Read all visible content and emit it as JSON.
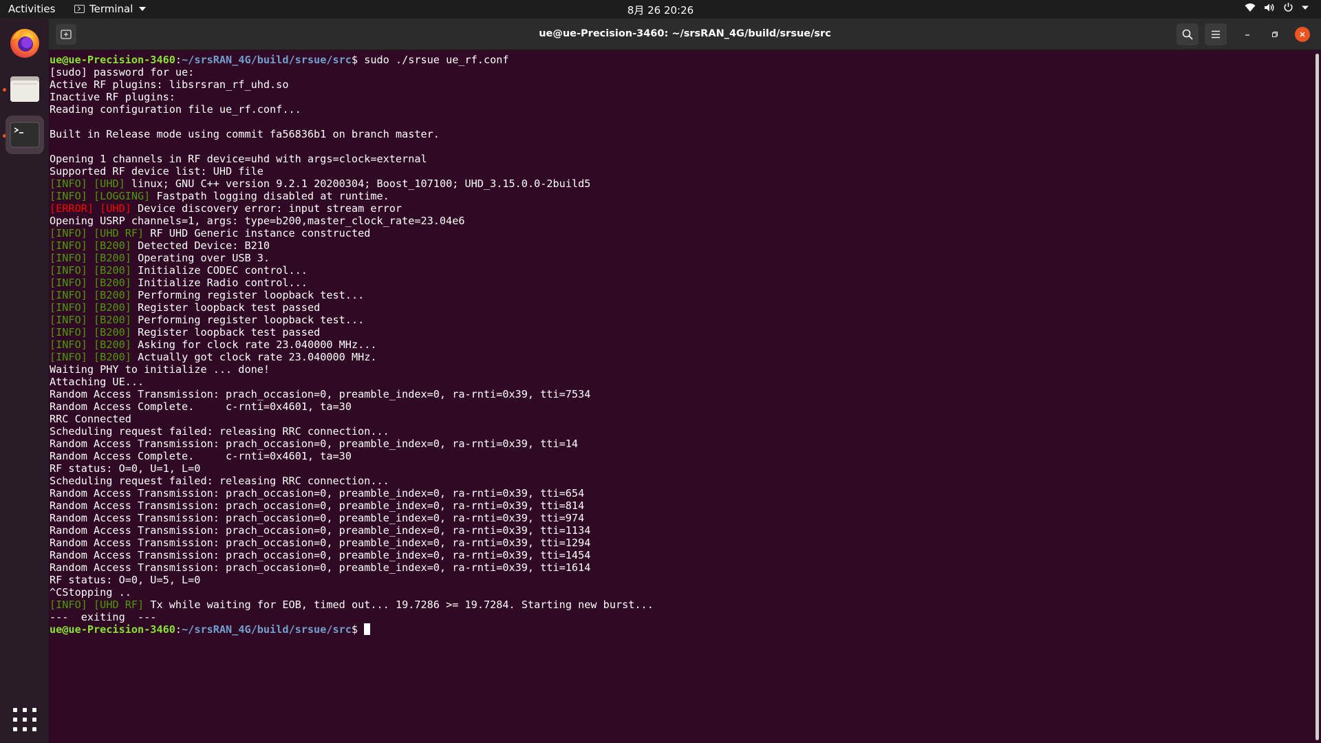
{
  "topbar": {
    "activities": "Activities",
    "app_name": "Terminal",
    "clock": "8月 26  20:26"
  },
  "window": {
    "title": "ue@ue-Precision-3460: ~/srsRAN_4G/build/srsue/src"
  },
  "colors": {
    "terminal_bg": "#300a24",
    "prompt_user": "#8ae234",
    "prompt_path": "#729fcf",
    "info_tag": "#4e9a06",
    "error_tag": "#ff0000",
    "close_button": "#e95420"
  },
  "icons": {
    "dock": [
      "firefox-icon",
      "files-icon",
      "terminal-icon",
      "show-apps-icon"
    ],
    "system": [
      "wifi-icon",
      "volume-icon",
      "power-icon",
      "chevron-down-icon"
    ],
    "header": [
      "new-tab-icon",
      "search-icon",
      "hamburger-menu-icon",
      "minimize-icon",
      "maximize-icon",
      "close-icon"
    ]
  },
  "terminal": {
    "prompt_user": "ue@ue-Precision-3460",
    "prompt_sep": ":",
    "prompt_path": "~/srsRAN_4G/build/srsue/src",
    "prompt_symbol": "$ ",
    "lines": [
      {
        "type": "prompt",
        "cmd": "sudo ./srsue ue_rf.conf"
      },
      {
        "type": "text",
        "text": "[sudo] password for ue:"
      },
      {
        "type": "text",
        "text": "Active RF plugins: libsrsran_rf_uhd.so"
      },
      {
        "type": "text",
        "text": "Inactive RF plugins:"
      },
      {
        "type": "text",
        "text": "Reading configuration file ue_rf.conf..."
      },
      {
        "type": "text",
        "text": ""
      },
      {
        "type": "text",
        "text": "Built in Release mode using commit fa56836b1 on branch master."
      },
      {
        "type": "text",
        "text": ""
      },
      {
        "type": "text",
        "text": "Opening 1 channels in RF device=uhd with args=clock=external"
      },
      {
        "type": "text",
        "text": "Supported RF device list: UHD file"
      },
      {
        "type": "log",
        "level": "[INFO]",
        "src": "[UHD]",
        "text": "linux; GNU C++ version 9.2.1 20200304; Boost_107100; UHD_3.15.0.0-2build5"
      },
      {
        "type": "log",
        "level": "[INFO]",
        "src": "[LOGGING]",
        "text": "Fastpath logging disabled at runtime."
      },
      {
        "type": "err",
        "level": "[ERROR]",
        "src": "[UHD]",
        "text": "Device discovery error: input stream error"
      },
      {
        "type": "text",
        "text": "Opening USRP channels=1, args: type=b200,master_clock_rate=23.04e6"
      },
      {
        "type": "log",
        "level": "[INFO]",
        "src": "[UHD RF]",
        "text": "RF UHD Generic instance constructed"
      },
      {
        "type": "log",
        "level": "[INFO]",
        "src": "[B200]",
        "text": "Detected Device: B210"
      },
      {
        "type": "log",
        "level": "[INFO]",
        "src": "[B200]",
        "text": "Operating over USB 3."
      },
      {
        "type": "log",
        "level": "[INFO]",
        "src": "[B200]",
        "text": "Initialize CODEC control..."
      },
      {
        "type": "log",
        "level": "[INFO]",
        "src": "[B200]",
        "text": "Initialize Radio control..."
      },
      {
        "type": "log",
        "level": "[INFO]",
        "src": "[B200]",
        "text": "Performing register loopback test..."
      },
      {
        "type": "log",
        "level": "[INFO]",
        "src": "[B200]",
        "text": "Register loopback test passed"
      },
      {
        "type": "log",
        "level": "[INFO]",
        "src": "[B200]",
        "text": "Performing register loopback test..."
      },
      {
        "type": "log",
        "level": "[INFO]",
        "src": "[B200]",
        "text": "Register loopback test passed"
      },
      {
        "type": "log",
        "level": "[INFO]",
        "src": "[B200]",
        "text": "Asking for clock rate 23.040000 MHz..."
      },
      {
        "type": "log",
        "level": "[INFO]",
        "src": "[B200]",
        "text": "Actually got clock rate 23.040000 MHz."
      },
      {
        "type": "text",
        "text": "Waiting PHY to initialize ... done!"
      },
      {
        "type": "text",
        "text": "Attaching UE..."
      },
      {
        "type": "text",
        "text": "Random Access Transmission: prach_occasion=0, preamble_index=0, ra-rnti=0x39, tti=7534"
      },
      {
        "type": "text",
        "text": "Random Access Complete.     c-rnti=0x4601, ta=30"
      },
      {
        "type": "text",
        "text": "RRC Connected"
      },
      {
        "type": "text",
        "text": "Scheduling request failed: releasing RRC connection..."
      },
      {
        "type": "text",
        "text": "Random Access Transmission: prach_occasion=0, preamble_index=0, ra-rnti=0x39, tti=14"
      },
      {
        "type": "text",
        "text": "Random Access Complete.     c-rnti=0x4601, ta=30"
      },
      {
        "type": "text",
        "text": "RF status: O=0, U=1, L=0"
      },
      {
        "type": "text",
        "text": "Scheduling request failed: releasing RRC connection..."
      },
      {
        "type": "text",
        "text": "Random Access Transmission: prach_occasion=0, preamble_index=0, ra-rnti=0x39, tti=654"
      },
      {
        "type": "text",
        "text": "Random Access Transmission: prach_occasion=0, preamble_index=0, ra-rnti=0x39, tti=814"
      },
      {
        "type": "text",
        "text": "Random Access Transmission: prach_occasion=0, preamble_index=0, ra-rnti=0x39, tti=974"
      },
      {
        "type": "text",
        "text": "Random Access Transmission: prach_occasion=0, preamble_index=0, ra-rnti=0x39, tti=1134"
      },
      {
        "type": "text",
        "text": "Random Access Transmission: prach_occasion=0, preamble_index=0, ra-rnti=0x39, tti=1294"
      },
      {
        "type": "text",
        "text": "Random Access Transmission: prach_occasion=0, preamble_index=0, ra-rnti=0x39, tti=1454"
      },
      {
        "type": "text",
        "text": "Random Access Transmission: prach_occasion=0, preamble_index=0, ra-rnti=0x39, tti=1614"
      },
      {
        "type": "text",
        "text": "RF status: O=0, U=5, L=0"
      },
      {
        "type": "text",
        "text": "^CStopping .."
      },
      {
        "type": "log",
        "level": "[INFO]",
        "src": "[UHD RF]",
        "text": "Tx while waiting for EOB, timed out... 19.7286 >= 19.7284. Starting new burst..."
      },
      {
        "type": "text",
        "text": "---  exiting  ---"
      },
      {
        "type": "prompt",
        "cmd": "",
        "cursor": true
      }
    ]
  }
}
